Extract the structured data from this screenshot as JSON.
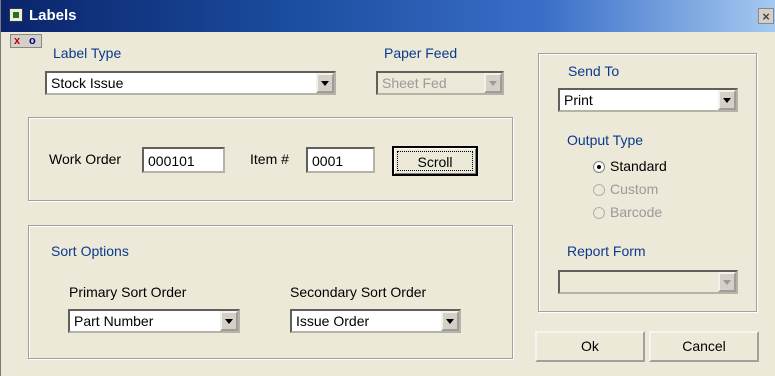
{
  "window": {
    "title": "Labels",
    "close": "×",
    "xo_x": "x",
    "xo_o": "o"
  },
  "label_type": {
    "label": "Label Type",
    "value": "Stock Issue"
  },
  "paper_feed": {
    "label": "Paper Feed",
    "value": "Sheet Fed"
  },
  "work": {
    "work_order_label": "Work Order",
    "work_order_value": "000101",
    "item_label": "Item #",
    "item_value": "0001",
    "scroll_label": "Scroll"
  },
  "sort": {
    "title": "Sort Options",
    "primary_label": "Primary Sort Order",
    "primary_value": "Part Number",
    "secondary_label": "Secondary Sort Order",
    "secondary_value": "Issue Order"
  },
  "send_to": {
    "label": "Send To",
    "value": "Print"
  },
  "output_type": {
    "label": "Output Type",
    "options": [
      "Standard",
      "Custom",
      "Barcode"
    ]
  },
  "report_form": {
    "label": "Report Form",
    "value": ""
  },
  "buttons": {
    "ok": "Ok",
    "cancel": "Cancel"
  }
}
